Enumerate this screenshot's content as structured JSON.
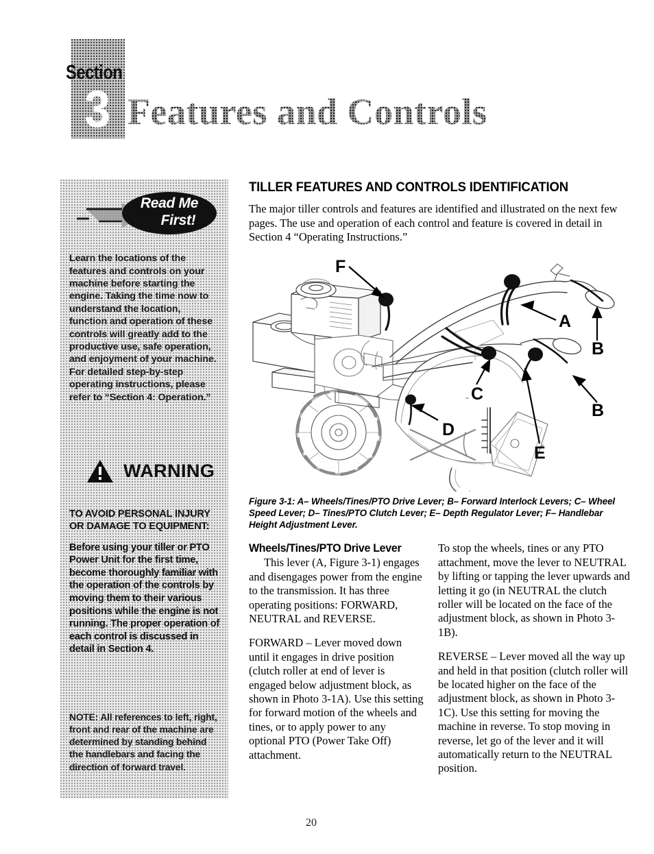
{
  "section_header": {
    "section_word": "Section",
    "section_number": "3",
    "section_title": "Features and Controls"
  },
  "sidebar": {
    "readme_badge": {
      "line1": "Read Me",
      "line2": "First!"
    },
    "readme_body": "Learn the locations of the features and controls on your machine before starting the engine.  Taking the time now to understand the location, function and operation of these controls will greatly add to the productive use, safe operation, and enjoyment of your machine. For detailed step-by-step operating instructions, please refer to “Section 4: Operation.”",
    "warning": {
      "title": "WARNING",
      "caption": "TO AVOID PERSONAL INJURY OR DAMAGE TO EQUIPMENT:",
      "body": "Before using your tiller or PTO Power Unit for the first time, become thoroughly familiar with the operation of the controls by moving them to their various positions while the engine is not running.  The proper operation of each control is discussed in detail in Section 4."
    },
    "note": "NOTE:  All references to left, right, front and rear of the machine are determined by standing behind the handlebars and facing the direction of forward travel."
  },
  "main": {
    "heading": "TILLER FEATURES AND CONTROLS IDENTIFICATION",
    "intro": "The major tiller controls and features are identified and illustrated on the next few pages.  The use and operation of each control and feature is covered in detail in Section 4 “Operating Instructions.”",
    "figure": {
      "caption": "Figure 3-1:  A– Wheels/Tines/PTO Drive Lever;  B– Forward Interlock Levers; C– Wheel Speed Lever; D– Tines/PTO Clutch Lever; E– Depth Regulator Lever; F– Handlebar Height Adjustment Lever.",
      "callouts": [
        {
          "label": "A",
          "target": "Wheels/Tines/PTO Drive Lever"
        },
        {
          "label": "B",
          "target": "Forward Interlock Levers"
        },
        {
          "label": "B",
          "target": "Forward Interlock Levers"
        },
        {
          "label": "C",
          "target": "Wheel Speed Lever"
        },
        {
          "label": "D",
          "target": "Tines/PTO Clutch Lever"
        },
        {
          "label": "E",
          "target": "Depth Regulator Lever"
        },
        {
          "label": "F",
          "target": "Handlebar Height Adjustment Lever"
        }
      ]
    },
    "columns": {
      "left": {
        "heading": "Wheels/Tines/PTO Drive Lever",
        "para1": "This lever (A, Figure 3-1) engages and disengages power from the engine to the transmission.  It has three operating positions: FORWARD, NEUTRAL and REVERSE.",
        "para2": "FORWARD – Lever moved down until it engages in drive position (clutch roller at end of lever is engaged below adjustment block, as shown in Photo 3-1A).  Use this setting for forward motion of the wheels and tines, or to apply power to any optional PTO (Power Take Off) attachment."
      },
      "right": {
        "para1": "To stop the wheels, tines or any PTO attachment, move the lever to NEUTRAL by lifting or tapping the lever upwards and letting it go (in NEUTRAL the clutch roller will be located on the face of the adjustment block, as shown in Photo 3-1B).",
        "para2": "REVERSE – Lever moved all the way up and held in that position (clutch roller will be located higher on the face of the adjustment block, as shown in Photo 3-1C).  Use this setting for moving the machine in reverse.  To stop moving in reverse, let go of the lever and it will automatically return to the NEUTRAL position."
      }
    }
  },
  "footer": {
    "page_number": "20"
  }
}
